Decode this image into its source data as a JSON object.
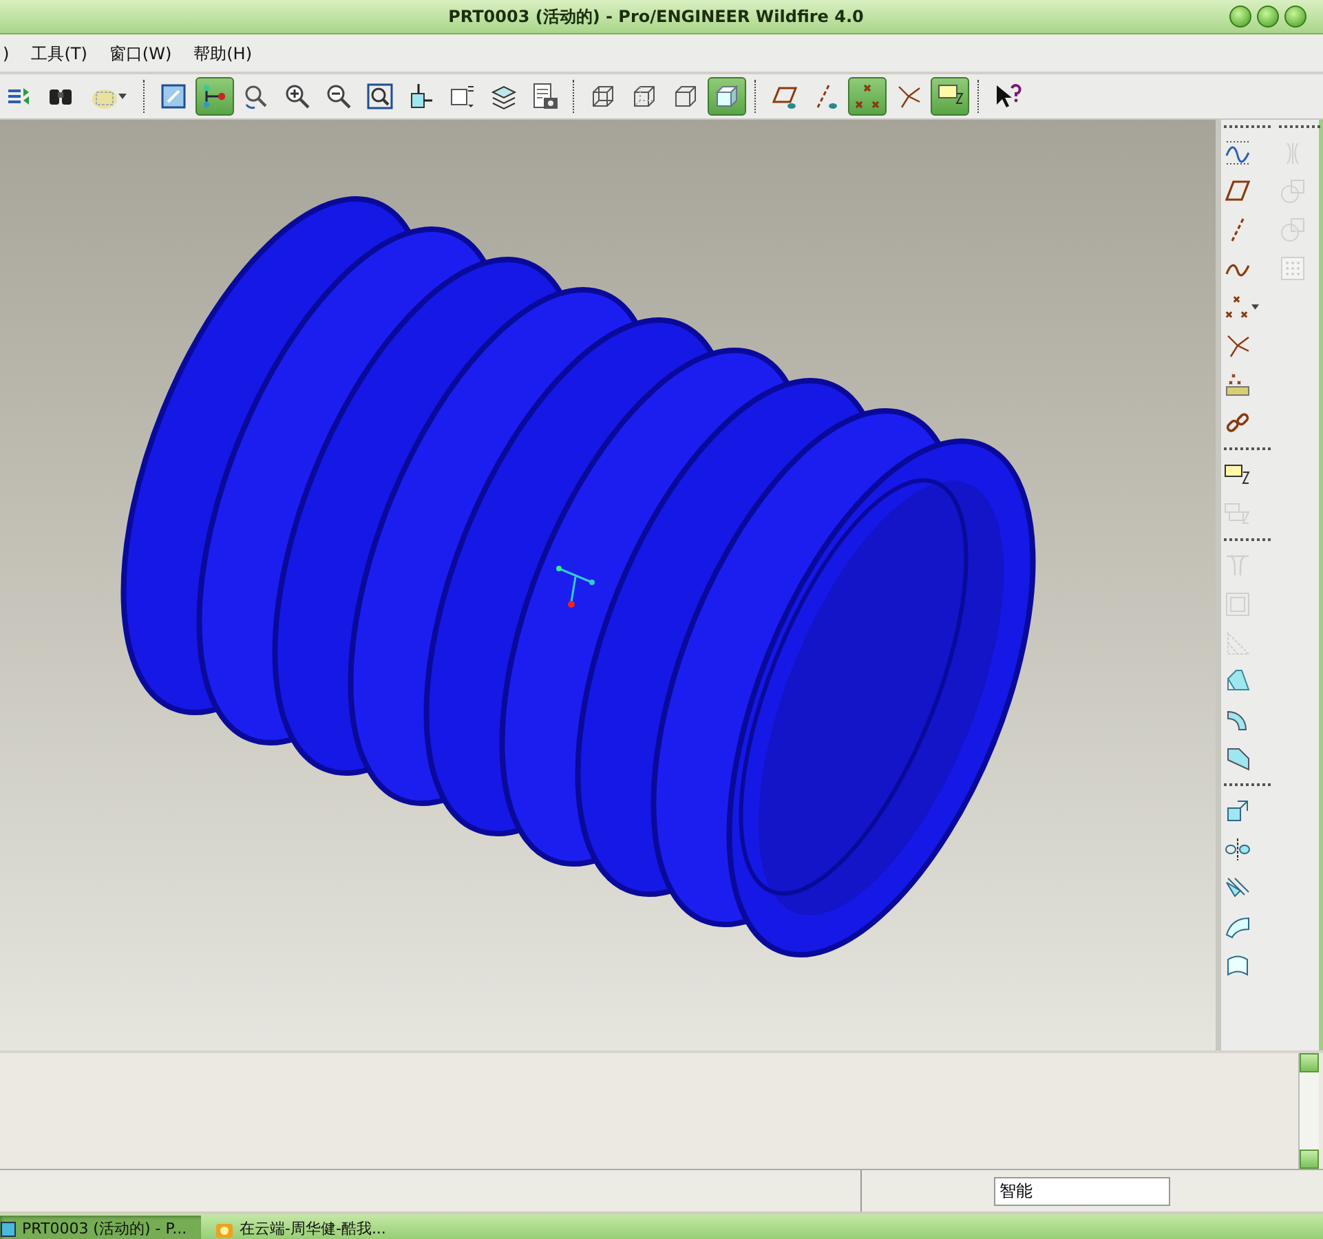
{
  "window": {
    "title": "PRT0003 (活动的) - Pro/ENGINEER Wildfire 4.0"
  },
  "menu": [
    {
      "label": ")"
    },
    {
      "label": "工具(T)"
    },
    {
      "label": "窗口(W)"
    },
    {
      "label": "帮助(H)"
    }
  ],
  "toolbar": [
    {
      "kind": "regenerate",
      "on": false
    },
    {
      "kind": "find",
      "on": false
    },
    {
      "kind": "select-filter",
      "on": false
    },
    {
      "kind": "separator"
    },
    {
      "kind": "repaint",
      "on": false
    },
    {
      "kind": "spin-center",
      "on": true
    },
    {
      "kind": "orient",
      "on": false
    },
    {
      "kind": "zoom-in",
      "on": false
    },
    {
      "kind": "zoom-out",
      "on": false
    },
    {
      "kind": "refit",
      "on": false
    },
    {
      "kind": "reorient",
      "on": false
    },
    {
      "kind": "saved-views",
      "on": false
    },
    {
      "kind": "layers",
      "on": false
    },
    {
      "kind": "view-manager",
      "on": false
    },
    {
      "kind": "separator"
    },
    {
      "kind": "wireframe",
      "on": false
    },
    {
      "kind": "hidden-line",
      "on": false
    },
    {
      "kind": "no-hidden",
      "on": false
    },
    {
      "kind": "shading",
      "on": true
    },
    {
      "kind": "separator"
    },
    {
      "kind": "planes",
      "on": false
    },
    {
      "kind": "axes",
      "on": false
    },
    {
      "kind": "points",
      "on": true
    },
    {
      "kind": "csys",
      "on": false
    },
    {
      "kind": "annotations",
      "on": true
    },
    {
      "kind": "separator"
    },
    {
      "kind": "help",
      "on": false
    }
  ],
  "side_toolbar": {
    "column_1": [
      {
        "kind": "separator"
      },
      {
        "kind": "dotted-curve",
        "disabled": false
      },
      {
        "kind": "plane",
        "disabled": false
      },
      {
        "kind": "axis",
        "disabled": false
      },
      {
        "kind": "curve",
        "disabled": false
      },
      {
        "kind": "points",
        "disabled": false
      },
      {
        "kind": "csys",
        "disabled": false
      },
      {
        "kind": "analysis",
        "disabled": false
      },
      {
        "kind": "chain",
        "disabled": false
      },
      {
        "kind": "separator"
      },
      {
        "kind": "sketch",
        "disabled": false
      },
      {
        "kind": "sketch-alt",
        "disabled": true
      },
      {
        "kind": "separator"
      },
      {
        "kind": "hole",
        "disabled": true
      },
      {
        "kind": "shell",
        "disabled": true
      },
      {
        "kind": "rib",
        "disabled": true
      },
      {
        "kind": "draft",
        "disabled": false
      },
      {
        "kind": "round",
        "disabled": false
      },
      {
        "kind": "chamfer",
        "disabled": false
      },
      {
        "kind": "separator"
      },
      {
        "kind": "extend",
        "disabled": false
      },
      {
        "kind": "mirror",
        "disabled": false
      },
      {
        "kind": "merge",
        "disabled": false
      },
      {
        "kind": "trim",
        "disabled": false
      },
      {
        "kind": "offset",
        "disabled": false
      }
    ],
    "column_2": [
      {
        "kind": "separator"
      },
      {
        "kind": "mirror",
        "disabled": true
      },
      {
        "kind": "merge",
        "disabled": true
      },
      {
        "kind": "intersect",
        "disabled": true
      },
      {
        "kind": "pattern",
        "disabled": true
      }
    ]
  },
  "status_bar": {
    "filter": "智能"
  },
  "taskbar": [
    {
      "label": "PRT0003 (活动的) - P...",
      "selected": true
    },
    {
      "label": "在云端-周华健-酷我...",
      "selected": false
    }
  ]
}
